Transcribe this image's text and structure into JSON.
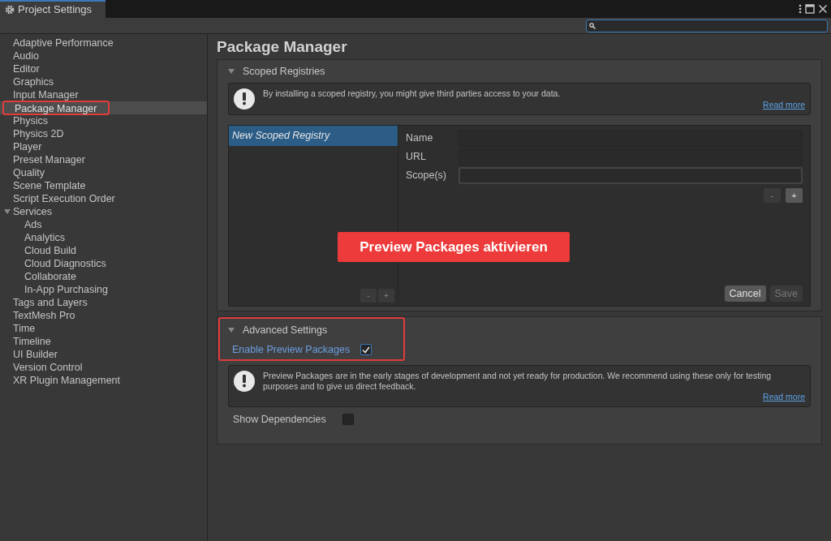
{
  "window": {
    "title": "Project Settings"
  },
  "sidebar": {
    "items": [
      {
        "label": "Adaptive Performance",
        "selected": false
      },
      {
        "label": "Audio",
        "selected": false
      },
      {
        "label": "Editor",
        "selected": false
      },
      {
        "label": "Graphics",
        "selected": false
      },
      {
        "label": "Input Manager",
        "selected": false
      },
      {
        "label": "Package Manager",
        "selected": true,
        "highlighted": true
      },
      {
        "label": "Physics",
        "selected": false
      },
      {
        "label": "Physics 2D",
        "selected": false
      },
      {
        "label": "Player",
        "selected": false
      },
      {
        "label": "Preset Manager",
        "selected": false
      },
      {
        "label": "Quality",
        "selected": false
      },
      {
        "label": "Scene Template",
        "selected": false
      },
      {
        "label": "Script Execution Order",
        "selected": false
      },
      {
        "label": "Services",
        "selected": false,
        "expanded": true,
        "children": [
          {
            "label": "Ads",
            "selected": false
          },
          {
            "label": "Analytics",
            "selected": false
          },
          {
            "label": "Cloud Build",
            "selected": false
          },
          {
            "label": "Cloud Diagnostics",
            "selected": false
          },
          {
            "label": "Collaborate",
            "selected": false
          },
          {
            "label": "In-App Purchasing",
            "selected": false
          }
        ]
      },
      {
        "label": "Tags and Layers",
        "selected": false
      },
      {
        "label": "TextMesh Pro",
        "selected": false
      },
      {
        "label": "Time",
        "selected": false
      },
      {
        "label": "Timeline",
        "selected": false
      },
      {
        "label": "UI Builder",
        "selected": false
      },
      {
        "label": "Version Control",
        "selected": false
      },
      {
        "label": "XR Plugin Management",
        "selected": false
      }
    ]
  },
  "page": {
    "title": "Package Manager",
    "scoped_registries": {
      "title": "Scoped Registries",
      "expanded": true,
      "info": {
        "text": "By installing a scoped registry, you might give third parties access to your data.",
        "link": "Read more"
      },
      "registries": [
        {
          "label": "New Scoped Registry",
          "selected": true
        }
      ],
      "list_buttons": [
        "-",
        "+"
      ],
      "fields": [
        {
          "label": "Name",
          "focused": false
        },
        {
          "label": "URL",
          "focused": false
        },
        {
          "label": "Scope(s)",
          "focused": true
        }
      ],
      "scope_buttons": [
        "-",
        "+"
      ],
      "actions": [
        {
          "label": "Cancel",
          "disabled": false
        },
        {
          "label": "Save",
          "disabled": true
        }
      ]
    },
    "annotation": "Preview Packages aktivieren",
    "advanced_settings": {
      "title": "Advanced Settings",
      "expanded": true,
      "highlighted": true,
      "enable_preview": {
        "label": "Enable Preview Packages",
        "checked": true
      },
      "info": {
        "text": "Preview Packages are in the early stages of development and not yet ready for production. We recommend using these only for testing purposes and to give us direct feedback.",
        "link": "Read more"
      },
      "show_dependencies": {
        "label": "Show Dependencies",
        "checked": false
      }
    }
  }
}
